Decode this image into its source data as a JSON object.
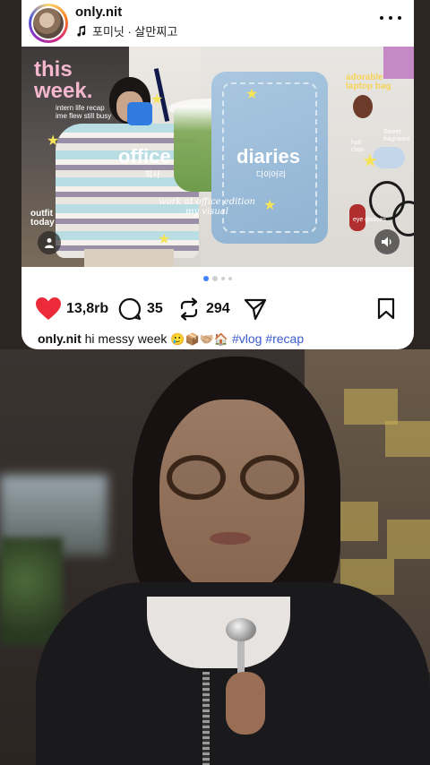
{
  "post": {
    "username": "only.nit",
    "audio": "포미닛 · 살만찌고",
    "media": {
      "title_this": "this",
      "title_week": "week.",
      "subtitle": "intern life recap\nime flew still busy",
      "office": "office",
      "office_kr": "회사",
      "diaries": "diaries",
      "diaries_kr": "다이어리",
      "edition": "work at office edition\nmy visual",
      "adorable": "adorable\nlaptop bag",
      "sweet": "Sweet\nfragrance",
      "hair": "hair\nclaw",
      "eyeglasses": "eye glasses",
      "outfit": "outfit\ntoday"
    },
    "carousel": {
      "total": 4,
      "active": 0
    },
    "likes": "13,8rb",
    "comments": "35",
    "reposts": "294",
    "caption_user": "only.nit",
    "caption_text": "hi messy week",
    "caption_emojis": "🥲📦🤝🏼🏠",
    "hashtags": "#vlog #recap"
  },
  "icons": {
    "music": "music-note-icon",
    "more": "more-horizontal-icon",
    "like": "heart-icon",
    "comment": "comment-icon",
    "repost": "repost-icon",
    "share": "send-icon",
    "save": "bookmark-icon",
    "user_tag": "user-icon",
    "mute": "speaker-icon"
  },
  "colors": {
    "like_red": "#ed2a3a",
    "hashtag_blue": "#3a5bd1",
    "dot_active": "#3e82f7"
  }
}
